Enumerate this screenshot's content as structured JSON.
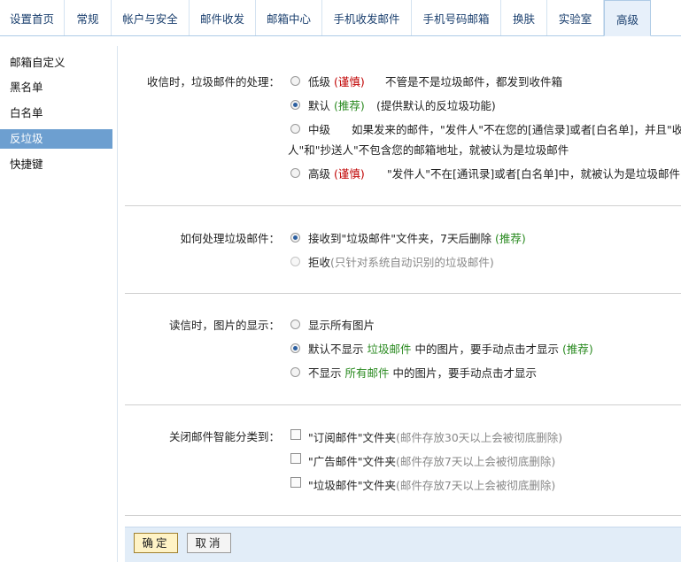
{
  "tabs": [
    {
      "label": "设置首页"
    },
    {
      "label": "常规"
    },
    {
      "label": "帐户与安全"
    },
    {
      "label": "邮件收发"
    },
    {
      "label": "邮箱中心"
    },
    {
      "label": "手机收发邮件"
    },
    {
      "label": "手机号码邮箱"
    },
    {
      "label": "换肤"
    },
    {
      "label": "实验室"
    },
    {
      "label": "高级",
      "active": true
    }
  ],
  "sidebar": {
    "items": [
      {
        "label": "邮箱自定义"
      },
      {
        "label": "黑名单"
      },
      {
        "label": "白名单"
      },
      {
        "label": "反垃圾",
        "active": true
      },
      {
        "label": "快捷键"
      }
    ]
  },
  "spam_handling": {
    "label": "收信时，垃圾邮件的处理：",
    "options": [
      {
        "name": "低级",
        "tag": "(谨慎)",
        "desc": "不管是不是垃圾邮件，都发到收件箱",
        "checked": false
      },
      {
        "name": "默认",
        "tag": "(推荐)",
        "desc": "(提供默认的反垃圾功能)",
        "checked": true
      },
      {
        "name": "中级",
        "desc_line1": "如果发来的邮件，\"发件人\"不在您的[通信录]或者[白名单]，并且\"收件",
        "desc_line2": "人\"和\"抄送人\"不包含您的邮箱地址，就被认为是垃圾邮件",
        "checked": false
      },
      {
        "name": "高级",
        "tag": "(谨慎)",
        "desc": "\"发件人\"不在[通讯录]或者[白名单]中，就被认为是垃圾邮件",
        "checked": false
      }
    ]
  },
  "spam_action": {
    "label": "如何处理垃圾邮件：",
    "options": [
      {
        "text": "接收到\"垃圾邮件\"文件夹，7天后删除",
        "tag": "(推荐)",
        "checked": true
      },
      {
        "name": "拒收",
        "note": "(只针对系统自动识别的垃圾邮件)",
        "checked": false,
        "disabled": true
      }
    ]
  },
  "image_display": {
    "label": "读信时，图片的显示：",
    "options": [
      {
        "text": "显示所有图片",
        "checked": false
      },
      {
        "pre": "默认不显示 ",
        "highlight": "垃圾邮件",
        "post": " 中的图片，要手动点击才显示",
        "tag": "(推荐)",
        "checked": true
      },
      {
        "pre": "不显示 ",
        "highlight": "所有邮件",
        "post": " 中的图片，要手动点击才显示",
        "checked": false
      }
    ]
  },
  "smart_category": {
    "label": "关闭邮件智能分类到：",
    "options": [
      {
        "text": "\"订阅邮件\"文件夹",
        "note": "(邮件存放30天以上会被彻底删除)",
        "checked": false
      },
      {
        "text": "\"广告邮件\"文件夹",
        "note": "(邮件存放7天以上会被彻底删除)",
        "checked": false
      },
      {
        "text": "\"垃圾邮件\"文件夹",
        "note": "(邮件存放7天以上会被彻底删除)",
        "checked": false
      }
    ]
  },
  "footer": {
    "confirm_label": "确定",
    "cancel_label": "取消"
  }
}
